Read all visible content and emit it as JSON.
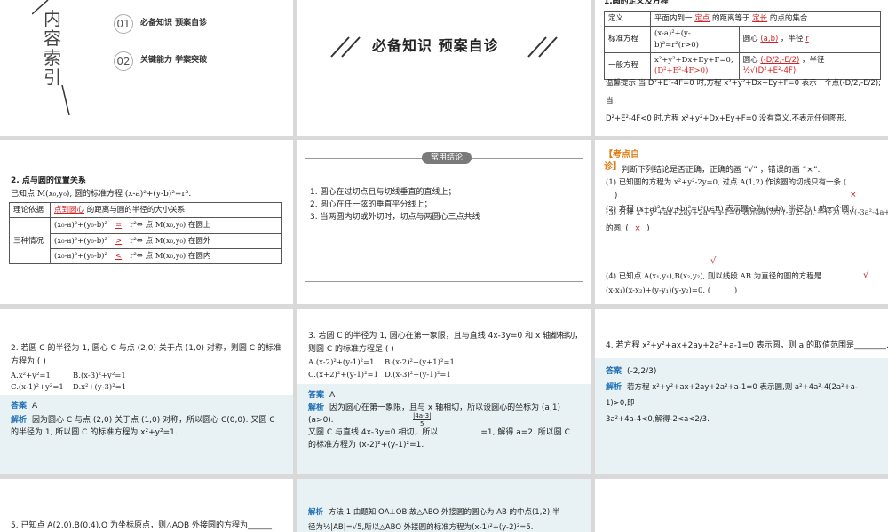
{
  "s1": {
    "title_chars": [
      "内",
      "容",
      "索",
      "引"
    ],
    "items": [
      {
        "num": "01",
        "label": "必备知识 预案自诊"
      },
      {
        "num": "02",
        "label": "关键能力 学案突破"
      }
    ]
  },
  "s2": {
    "heading": "必备知识 预案自诊"
  },
  "s3": {
    "heading": "1.圆的定义及方程",
    "rows": [
      {
        "k": "定义",
        "v1": "平面内到一",
        "f1": "定点",
        "v2": "的距离等于",
        "f2": "定长",
        "v3": "的点的集合"
      },
      {
        "k": "标准方程",
        "v1": "(x-a)²+(y-b)²=r²(r>0)",
        "c": "圆心",
        "f1": "(a,b)",
        "c2": "，半径",
        "f2": "r"
      },
      {
        "k": "一般方程",
        "v1": "x²+y²+Dx+Ey+F=0,",
        "f0": "(D²+E²-4F>0)",
        "c": "圆心",
        "f1": "(-D/2,-E/2)",
        "c2": "，半径",
        "f2": "½√(D²+E²-4F)"
      }
    ],
    "tip1": "温馨提示 当 D²+E²-4F=0 时,方程 x²+y²+Dx+Ey+F=0 表示一个点(-D/2,-E/2);当",
    "tip2": "D²+E²-4F<0 时,方程 x²+y²+Dx+Ey+F=0 没有意义,不表示任何图形."
  },
  "s4": {
    "heading": "2. 点与圆的位置关系",
    "intro": "已知点 M(x₀,y₀), 圆的标准方程 (x-a)²+(y-b)²=r².",
    "r1k": "理论依据",
    "r1f": "点到圆心",
    "r1v": "的距离与圆的半径的大小关系",
    "r2k": "三种情况",
    "cases": [
      {
        "a": "(x₀-a)²+(y₀-b)²",
        "sym": "=",
        "b": "r²⇔ 点 M(x₀,y₀) 在圆上"
      },
      {
        "a": "(x₀-a)²+(y₀-b)²",
        "sym": ">",
        "b": "r²⇔ 点 M(x₀,y₀) 在圆外"
      },
      {
        "a": "(x₀-a)²+(y₀-b)²",
        "sym": "<",
        "b": "r²⇔ 点 M(x₀,y₀) 在圆内"
      }
    ]
  },
  "s5": {
    "badge": "常用结论",
    "lines": [
      "1. 圆心在过切点且与切线垂直的直线上；",
      "2. 圆心在任一弦的垂直平分线上；",
      "3. 当两圆内切或外切时，切点与两圆心三点共线"
    ]
  },
  "s6": {
    "tag1": "【考点自",
    "tag2": "诊】",
    "intro": "判断下列结论是否正确，正确的画 “√” ，错误的画 “×”.",
    "q1": "(1) 已知圆的方程为 x²+y²-2y=0, 过点 A(1,2) 作该圆的切线只有一条.(",
    "q1b": ")",
    "m1": "×",
    "q2": "(2) 方程 (x+a)²+(y+b)²=t²(t∈R) 表示圆心为 (a,b), 半径为 t 的一个圆.(",
    "q3": "(3) 方程 x²+y²+ax+2ay+2a²+a-1=0 表示圆心为 (-a/2,-a), 半径为 ½√(-3a²-4a+4)",
    "q3b": "的圆. (",
    "m3": "×",
    "q3c": ")",
    "m4": "√",
    "q4": "(4) 已知点 A(x₁,y₁),B(x₂,y₂), 则以线段 AB 为直径的圆的方程是",
    "q4b": "(x-x₁)(x-x₂)+(y-y₁)(y-y₂)=0. (",
    "q4c": ")",
    "m4b": "√"
  },
  "s7": {
    "q1": "2. 若圆 C 的半径为 1, 圆心 C 与点 (2,0) 关于点 (1,0) 对称，则圆 C 的标准",
    "q2": "方程为 (        )",
    "optA": "A.x²+y²=1",
    "optB": "B.(x-3)²+y²=1",
    "optC": "C.(x-1)²+y²=1",
    "optD": "D.x²+(y-3)²=1",
    "ans_lbl": "答案",
    "ans": "A",
    "jx_lbl": "解析",
    "jx": "因为圆心 C 与点 (2,0) 关于点 (1,0) 对称，所以圆心 C(0,0). 又圆 C 的半径为 1, 所以圆 C 的标准方程为 x²+y²=1."
  },
  "s8": {
    "q1": "3. 若圆 C 的半径为 1, 圆心在第一象限，且与直线 4x-3y=0 和 x 轴都相切，",
    "q2": "则圆 C 的标准方程是 (        )",
    "optA": "A.(x-2)²+(y-1)²=1",
    "optB": "B.(x-2)²+(y+1)²=1",
    "optC": "C.(x+2)²+(y-1)²=1",
    "optD": "D.(x-3)²+(y-1)²=1",
    "ans_lbl": "答案",
    "ans": "A",
    "jx_lbl": "解析",
    "jx1": "因为圆心在第一象限，且与 x 轴相切，所以设圆心的坐标为 (a,1)",
    "jx2": "(a>0).",
    "frac": "|4a-3|",
    "den": "5",
    "jx3": "又圆 C 与直线 4x-3y=0 相切，所以",
    "jx4": "=1, 解得 a=2. 所以圆 C",
    "jx5": "的标准方程为 (x-2)²+(y-1)²=1."
  },
  "s9": {
    "q": "4. 若方程 x²+y²+ax+2ay+2a²+a-1=0 表示圆，则 a 的取值范围是________.",
    "ans_lbl": "答案",
    "ans": "(-2,2/3)",
    "jx_lbl": "解析",
    "jx1": "若方程 x²+y²+ax+2ay+2a²+a-1=0 表示圆,则 a²+4a²-4(2a²+a-1)>0,即",
    "jx2": "3a²+4a-4<0,解得-2<a<2/3."
  },
  "s10": {
    "q": "5. 已知点 A(2,0),B(0,4),O 为坐标原点，则△AOB 外接圆的方程为______"
  },
  "s11": {
    "jx_lbl": "解析",
    "jx1": "方法 1  由题知 OA⊥OB,故△ABO 外接圆的圆心为 AB 的中点(1,2),半",
    "jx2": "径为½|AB|=√5,所以△ABO 外接圆的标准方程为(x-1)²+(y-2)²=5."
  },
  "colors": {
    "accent": "#1f6fb5",
    "fill": "#d32020",
    "answer_bg": "#e8f1f4",
    "tag": "#e07a10"
  }
}
